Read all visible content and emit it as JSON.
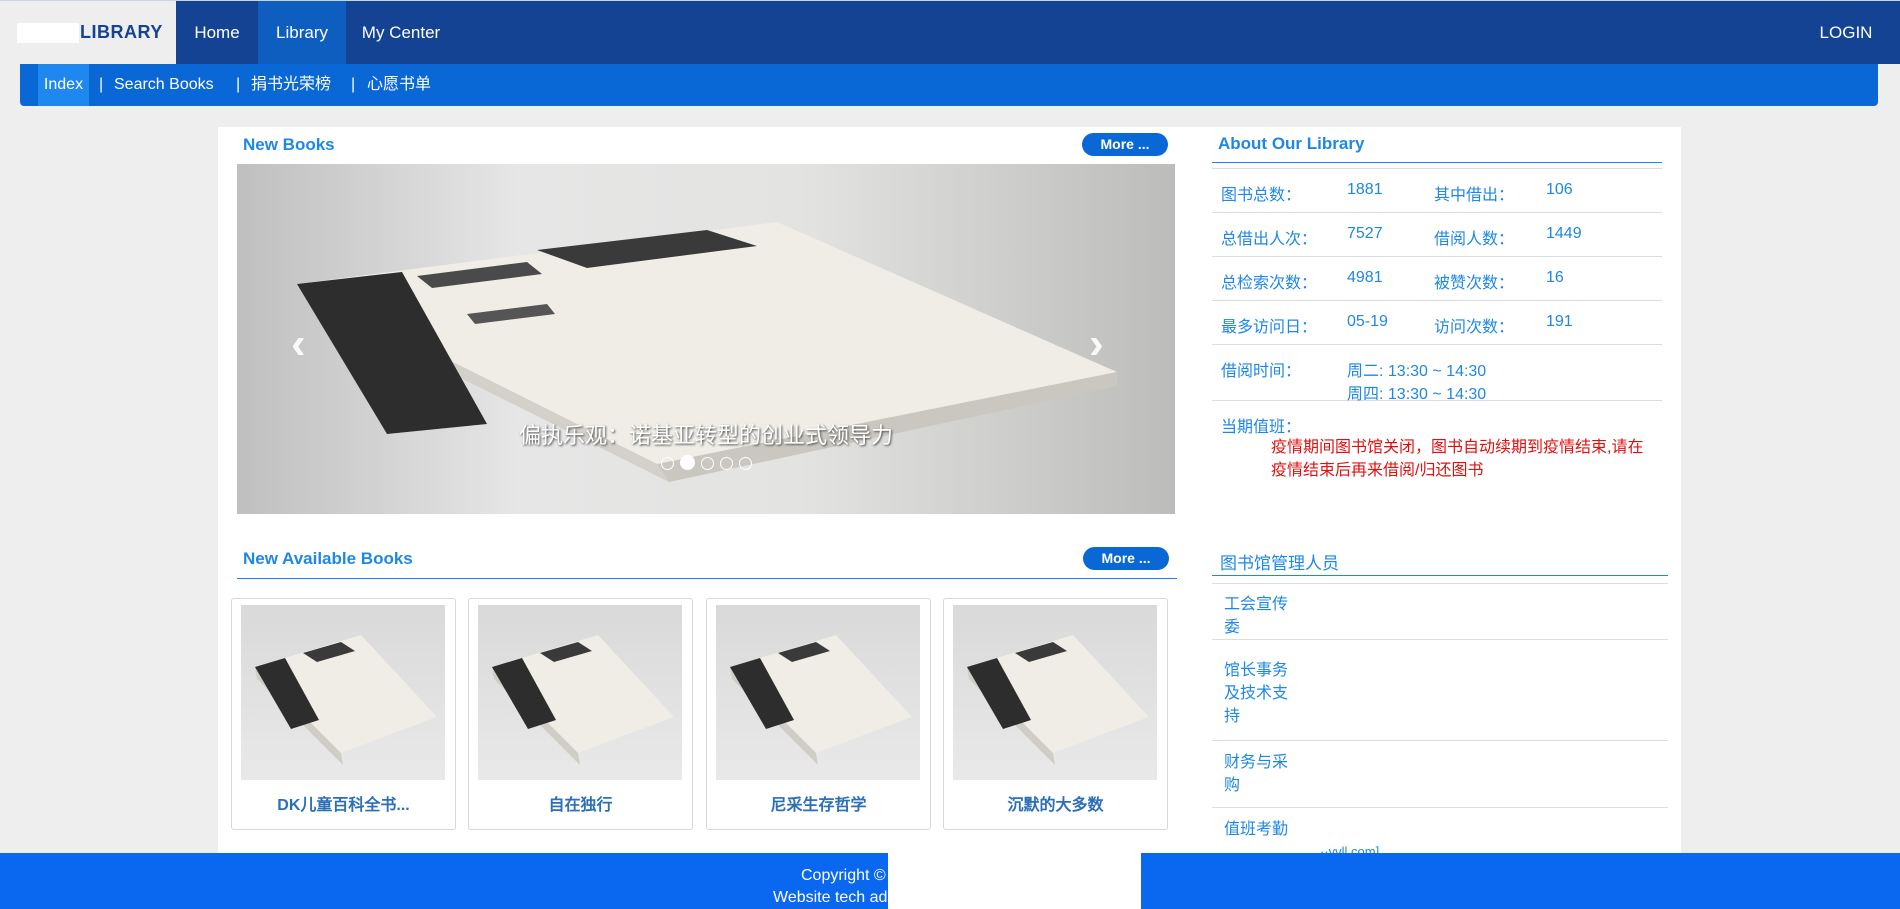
{
  "header": {
    "brand": "LIBRARY",
    "nav": [
      "Home",
      "Library",
      "My Center"
    ],
    "active_nav": "Library",
    "login": "LOGIN"
  },
  "subnav": {
    "items": [
      "Index",
      "Search Books",
      "捐书光荣榜",
      "心愿书单"
    ],
    "separator": "|"
  },
  "new_books": {
    "title": "New Books",
    "more": "More ...",
    "caption": "偏执乐观：诺基亚转型的创业式领导力",
    "prev": "‹",
    "next": "›"
  },
  "about": {
    "title": "About Our Library",
    "rows": [
      {
        "k1": "图书总数：",
        "v1": "1881",
        "k2": "其中借出：",
        "v2": "106"
      },
      {
        "k1": "总借出人次：",
        "v1": "7527",
        "k2": "借阅人数：",
        "v2": "1449"
      },
      {
        "k1": "总检索次数：",
        "v1": "4981",
        "k2": "被赞次数：",
        "v2": "16"
      },
      {
        "k1": "最多访问日：",
        "v1": "05-19",
        "k2": "访问次数：",
        "v2": "191"
      }
    ],
    "hours_label": "借阅时间：",
    "hours": [
      "周二: 13:30 ~ 14:30",
      "周四: 13:30 ~ 14:30"
    ],
    "duty_label": "当期值班：",
    "notice": "疫情期间图书馆关闭，图书自动续期到疫情结束,请在疫情结束后再来借阅/归还图书"
  },
  "available": {
    "title": "New Available Books",
    "more": "More ...",
    "books": [
      "DK儿童百科全书...",
      "自在独行",
      "尼采生存哲学",
      "沉默的大多数"
    ]
  },
  "staff": {
    "title": "图书馆管理人员",
    "roles": [
      "工会宣传委",
      "馆长事务及技术支持",
      "财务与采购",
      "值班考勤"
    ],
    "partial": "··vvll.com]"
  },
  "footer": {
    "copyright": "Copyright ©",
    "tech": "Website tech ad"
  }
}
